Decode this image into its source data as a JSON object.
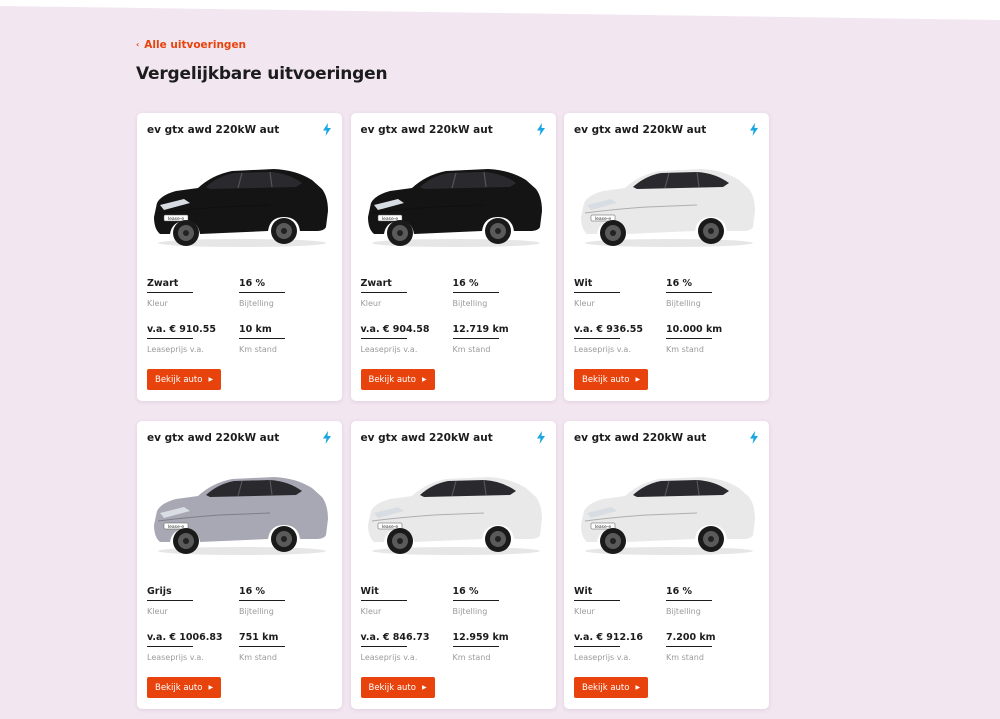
{
  "back_link": {
    "label": "Alle uitvoeringen"
  },
  "page": {
    "title": "Vergelijkbare uitvoeringen"
  },
  "colors": {
    "accent": "#e8430c",
    "bolt": "#1aa6e0",
    "background": "#f2e6f1"
  },
  "spec_labels": {
    "color": "Kleur",
    "tax": "Bijtelling",
    "price": "Leaseprijs v.a.",
    "km": "Km stand"
  },
  "cards": [
    {
      "title": "ev gtx awd 220kW aut",
      "color": "Zwart",
      "tax": "16 %",
      "price": "v.a. € 910.55",
      "km": "10 km",
      "cta": "Bekijk auto",
      "car_paint": "#141414",
      "car_plate": "lease-e"
    },
    {
      "title": "ev gtx awd 220kW aut",
      "color": "Zwart",
      "tax": "16 %",
      "price": "v.a. € 904.58",
      "km": "12.719 km",
      "cta": "Bekijk auto",
      "car_paint": "#141414",
      "car_plate": "lease-e"
    },
    {
      "title": "ev gtx awd 220kW aut",
      "color": "Wit",
      "tax": "16 %",
      "price": "v.a. € 936.55",
      "km": "10.000 km",
      "cta": "Bekijk auto",
      "car_paint": "#e9e9e9",
      "car_plate": "lease-e"
    },
    {
      "title": "ev gtx awd 220kW aut",
      "color": "Grijs",
      "tax": "16 %",
      "price": "v.a. € 1006.83",
      "km": "751 km",
      "cta": "Bekijk auto",
      "car_paint": "#a8a8b4",
      "car_plate": "lease-e"
    },
    {
      "title": "ev gtx awd 220kW aut",
      "color": "Wit",
      "tax": "16 %",
      "price": "v.a. € 846.73",
      "km": "12.959 km",
      "cta": "Bekijk auto",
      "car_paint": "#e9e9e9",
      "car_plate": "lease-e"
    },
    {
      "title": "ev gtx awd 220kW aut",
      "color": "Wit",
      "tax": "16 %",
      "price": "v.a. € 912.16",
      "km": "7.200 km",
      "cta": "Bekijk auto",
      "car_paint": "#e9e9e9",
      "car_plate": "lease-e"
    }
  ]
}
